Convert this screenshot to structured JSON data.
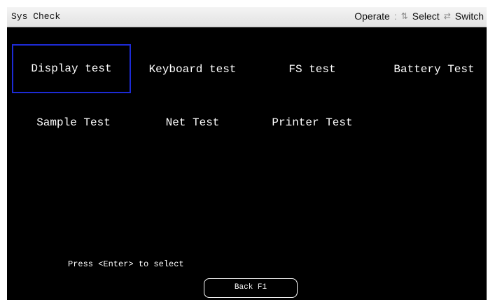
{
  "header": {
    "title": "Sys Check",
    "operate_label": "Operate",
    "select_label": "Select",
    "switch_label": "Switch",
    "select_icon": "select-arrows-icon",
    "switch_icon": "switch-arrows-icon"
  },
  "menu": {
    "items": [
      {
        "label": "Display test",
        "selected": true
      },
      {
        "label": "Keyboard test",
        "selected": false
      },
      {
        "label": "FS test",
        "selected": false
      },
      {
        "label": "Battery Test",
        "selected": false
      },
      {
        "label": "Sample Test",
        "selected": false
      },
      {
        "label": "Net Test",
        "selected": false
      },
      {
        "label": "Printer Test",
        "selected": false
      }
    ]
  },
  "footer": {
    "prompt": "Press <Enter> to select",
    "back_label": "Back F1"
  },
  "colors": {
    "selection_border": "#1d2bd6",
    "panel_background": "#000000",
    "text": "#ffffff"
  }
}
